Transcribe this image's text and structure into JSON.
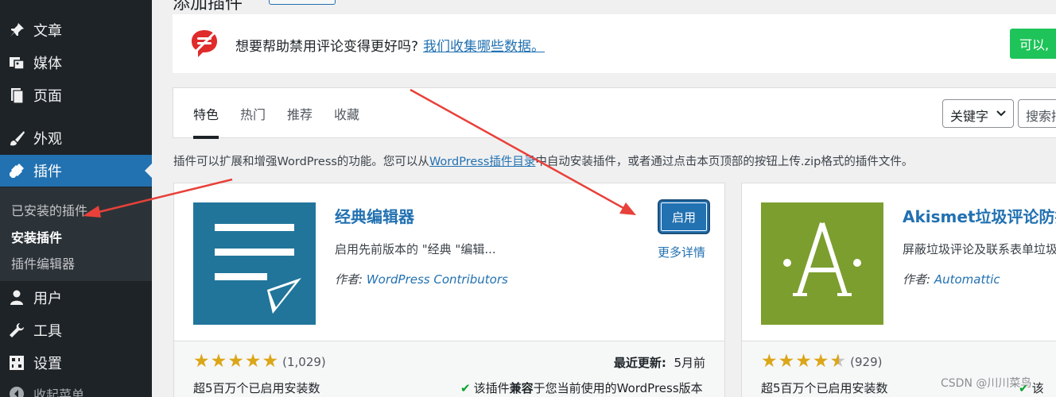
{
  "sidebar": {
    "items": [
      {
        "label": "文章",
        "icon": "pin-icon"
      },
      {
        "label": "媒体",
        "icon": "media-icon"
      },
      {
        "label": "页面",
        "icon": "page-icon"
      },
      {
        "label": "外观",
        "icon": "brush-icon"
      },
      {
        "label": "插件",
        "icon": "plug-icon"
      },
      {
        "label": "用户",
        "icon": "user-icon"
      },
      {
        "label": "工具",
        "icon": "wrench-icon"
      },
      {
        "label": "设置",
        "icon": "settings-icon"
      },
      {
        "label": "收起菜单",
        "icon": "collapse-icon"
      }
    ],
    "submenu": [
      "已安装的插件",
      "安装插件",
      "插件编辑器"
    ]
  },
  "header": {
    "title_partial": "添加插件"
  },
  "notice": {
    "text": "想要帮助禁用评论变得更好吗?",
    "link": "我们收集哪些数据。",
    "button": "可以,"
  },
  "filter": {
    "tabs": [
      "特色",
      "热门",
      "推荐",
      "收藏"
    ],
    "search_type": "关键字",
    "search_placeholder": "搜索插"
  },
  "description": {
    "before": "插件可以扩展和增强WordPress的功能。您可以从",
    "link": "WordPress插件目录",
    "after": "中自动安装插件，或者通过点击本页顶部的按钮上传.zip格式的插件文件。"
  },
  "plugins": [
    {
      "name": "经典编辑器",
      "desc": "启用先前版本的 \"经典 \"编辑...",
      "author_label": "作者:",
      "author": "WordPress Contributors",
      "activate": "启用",
      "details": "更多详情",
      "rating": 5,
      "rating_count": "(1,029)",
      "installs": "超5百万个已启用安装数",
      "updated_label": "最近更新:",
      "updated_value": "5月前",
      "compat_before": "该插件",
      "compat_bold": "兼容",
      "compat_after": "于您当前使用的WordPress版本"
    },
    {
      "name": "Akismet垃圾评论防护",
      "desc": "屏蔽垃圾评论及联系表单垃圾",
      "author_label": "作者:",
      "author": "Automattic",
      "rating": 4.5,
      "rating_count": "(929)",
      "installs": "超5百万个已启用安装数",
      "compat_partial": "该"
    }
  ],
  "watermark": "CSDN @川川菜鸟",
  "colors": {
    "sidebar": "#1d2327",
    "accent": "#2271b1",
    "classic_icon_bg": "#21759b",
    "akismet_icon_bg": "#7c9e2e",
    "annotation": "#e8413a",
    "star": "#dba617"
  }
}
